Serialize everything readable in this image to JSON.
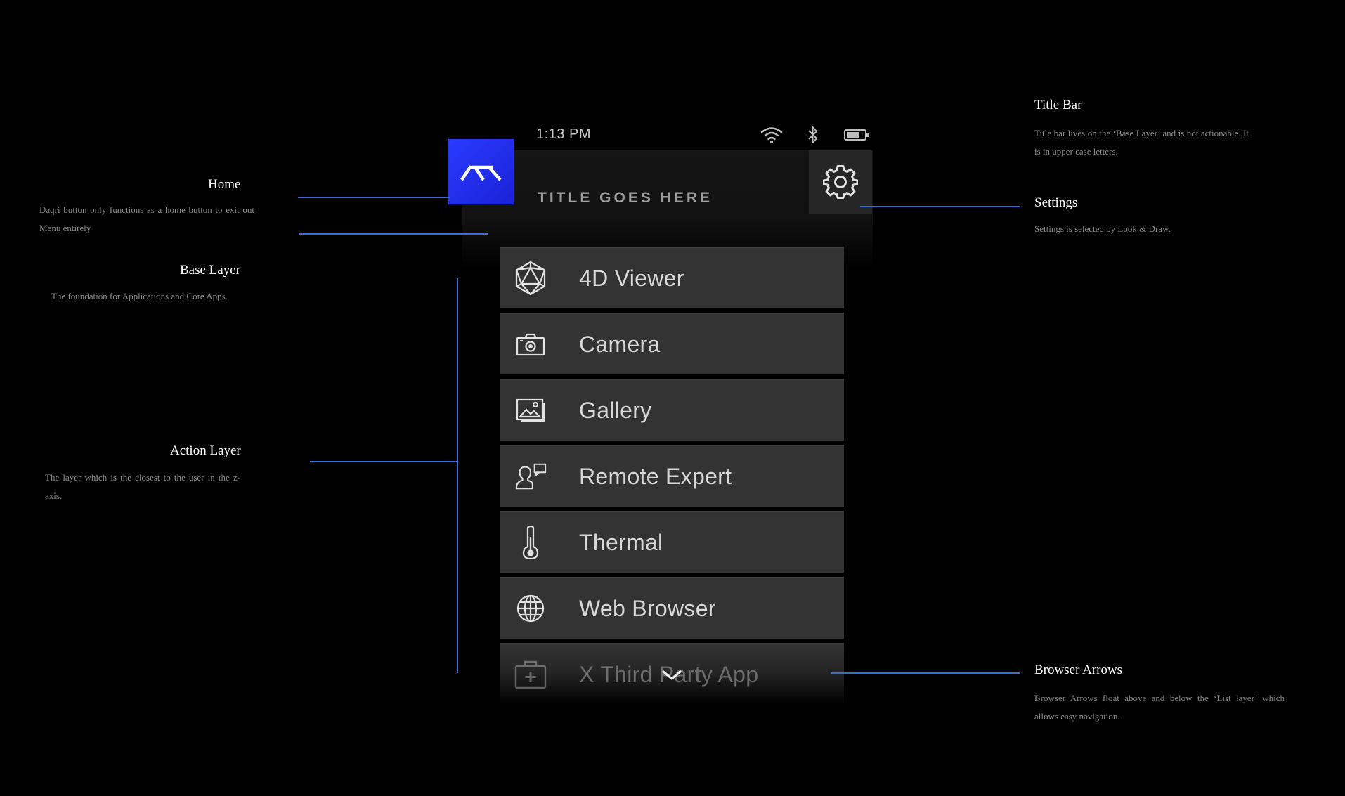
{
  "status_bar": {
    "time": "1:13 PM",
    "icons": [
      "wifi-icon",
      "bluetooth-icon",
      "battery-icon"
    ]
  },
  "title_bar": {
    "title": "TITLE GOES HERE"
  },
  "home_button": {
    "icon": "daqri-logo-icon",
    "color": "#2a3bff"
  },
  "settings_button": {
    "icon": "gear-icon"
  },
  "menu": {
    "items": [
      {
        "label": "4D Viewer",
        "icon": "icosahedron-icon"
      },
      {
        "label": "Camera",
        "icon": "camera-icon"
      },
      {
        "label": "Gallery",
        "icon": "gallery-icon"
      },
      {
        "label": "Remote Expert",
        "icon": "remote-expert-icon"
      },
      {
        "label": "Thermal",
        "icon": "thermometer-icon"
      },
      {
        "label": "Web Browser",
        "icon": "globe-icon"
      },
      {
        "label": "X Third Party App",
        "icon": "medkit-icon"
      }
    ],
    "scroll_icon": "chevron-down-icon"
  },
  "annotations": {
    "home": {
      "title": "Home",
      "desc": "Daqri button only functions as a home button to exit out Menu entirely"
    },
    "base_layer": {
      "title": "Base Layer",
      "desc": "The foundation  for Applications and Core Apps."
    },
    "action_layer": {
      "title": "Action Layer",
      "desc": "The layer which is the closest to the user in the z-axis."
    },
    "title_bar": {
      "title": "Title Bar",
      "desc": "Title bar lives on the ‘Base Layer’ and is not actionable. It is in upper case letters."
    },
    "settings": {
      "title": "Settings",
      "desc": "Settings is selected by Look & Draw."
    },
    "browser_arrows": {
      "title": "Browser Arrows",
      "desc": "Browser Arrows float above and below the ‘List layer’ which allows easy navigation."
    }
  },
  "colors": {
    "accent_line": "#3b6bd6",
    "menu_item_bg": "#333333",
    "background": "#000000"
  }
}
